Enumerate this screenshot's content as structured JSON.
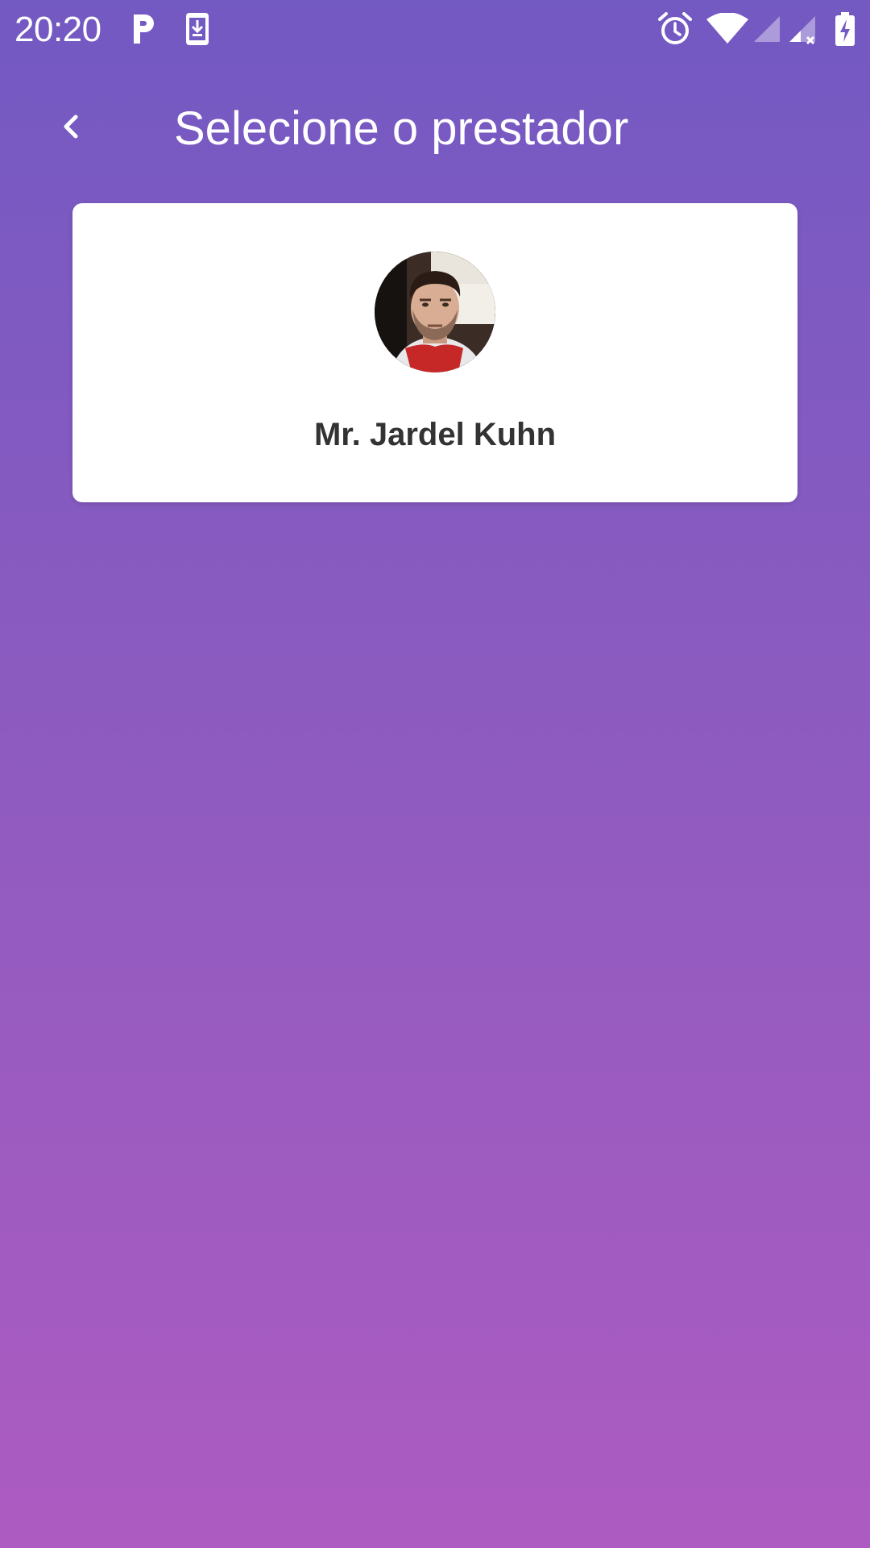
{
  "status_bar": {
    "time": "20:20",
    "icons": [
      "p-app-icon",
      "download-icon",
      "alarm-icon",
      "wifi-icon",
      "signal-icon",
      "signal-no-sim-icon",
      "battery-charging-icon"
    ]
  },
  "app_bar": {
    "title": "Selecione o prestador",
    "back_icon": "chevron-left-icon"
  },
  "providers": [
    {
      "name": "Mr. Jardel Kuhn",
      "avatar_icon": "avatar-photo"
    }
  ],
  "colors": {
    "gradient_top": "#7359c2",
    "gradient_bottom": "#ad5bc1",
    "card_background": "#ffffff",
    "provider_name_text": "#333333"
  }
}
